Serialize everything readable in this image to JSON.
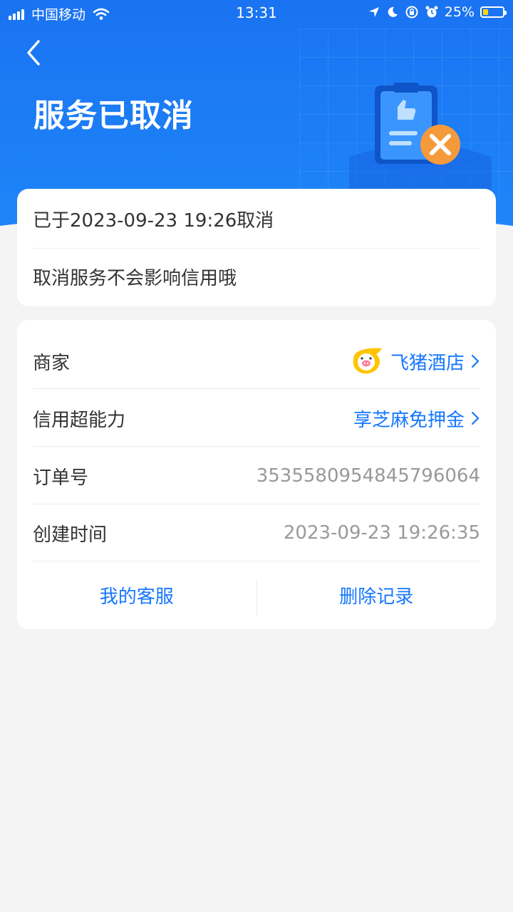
{
  "status_bar": {
    "carrier": "中国移动",
    "time": "13:31",
    "battery_percent": "25%",
    "battery_level": 0.25,
    "icons": [
      "signal-icon",
      "wifi-icon",
      "location-icon",
      "moon-icon",
      "rotation-lock-icon",
      "alarm-icon",
      "battery-icon"
    ]
  },
  "header": {
    "title": "服务已取消",
    "back_icon": "chevron-left-icon",
    "illustration": "cancelled-document-icon"
  },
  "notice": {
    "cancel_time_text": "已于2023-09-23 19:26取消",
    "credit_note": "取消服务不会影响信用哦"
  },
  "details": {
    "merchant": {
      "label": "商家",
      "value": "飞猪酒店"
    },
    "credit": {
      "label": "信用超能力",
      "value": "享芝麻免押金"
    },
    "order_no": {
      "label": "订单号",
      "value": "3535580954845796064"
    },
    "created_at": {
      "label": "创建时间",
      "value": "2023-09-23 19:26:35"
    }
  },
  "actions": {
    "customer_service": "我的客服",
    "delete_record": "删除记录"
  },
  "colors": {
    "header_blue": "#1a73f2",
    "link_blue": "#1677ff",
    "page_bg": "#f4f4f4",
    "cancel_orange": "#f59a3a"
  }
}
